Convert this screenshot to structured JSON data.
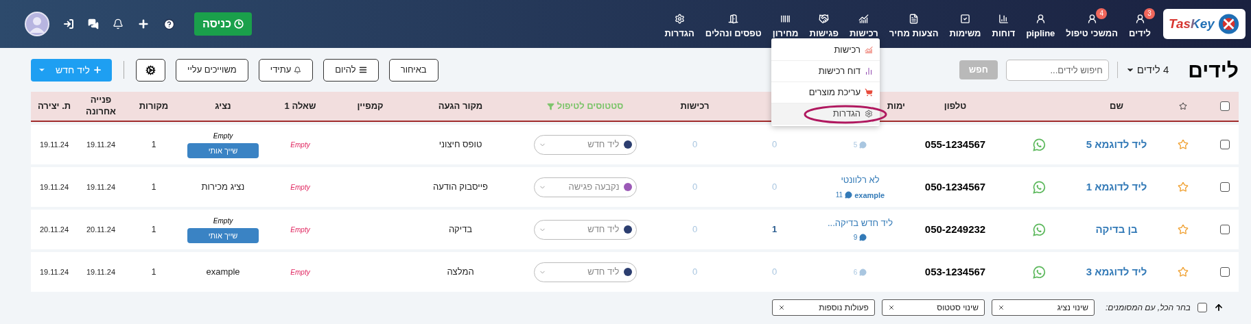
{
  "nav": {
    "logo": "TasKey",
    "items": [
      {
        "label": "לידים",
        "badge": "3"
      },
      {
        "label": "המשכי טיפול",
        "badge": "4"
      },
      {
        "label": "pipline"
      },
      {
        "label": "דוחות"
      },
      {
        "label": "משימות"
      },
      {
        "label": "הצעות מחיר"
      },
      {
        "label": "רכישות"
      },
      {
        "label": "פגישות"
      },
      {
        "label": "מחירון"
      },
      {
        "label": "טפסים ונהלים"
      },
      {
        "label": "הגדרות"
      }
    ],
    "checkin": "כניסה"
  },
  "menu": {
    "items": [
      {
        "label": "רכישות",
        "selected": false,
        "circled": false
      },
      {
        "label": "דוח רכישות",
        "selected": false,
        "circled": false
      },
      {
        "label": "עריכת מוצרים",
        "selected": false,
        "circled": false
      },
      {
        "label": "הגדרות",
        "selected": true,
        "circled": true
      }
    ]
  },
  "toolbar": {
    "title": "לידים",
    "count": "4 לידים",
    "search": {
      "placeholder": "חיפוש לידים..."
    },
    "search_button": {
      "label": "חפש",
      "disabled": true
    },
    "filters": [
      "באיחור",
      "להיום",
      "עתידי",
      "משוייכים עליי"
    ],
    "new_lead": "ליד חדש"
  },
  "table": {
    "columns": [
      {
        "kind": "checkbox",
        "checked": false
      },
      {
        "kind": "star"
      },
      {
        "kind": "text",
        "label": "שם"
      },
      {
        "kind": "blank"
      },
      {
        "kind": "text",
        "label": "טלפון"
      },
      {
        "kind": "partial",
        "label": "ימות"
      },
      {
        "kind": "blank"
      },
      {
        "kind": "text",
        "label": "רכישות"
      },
      {
        "kind": "filter",
        "label": "סטטוסים לטיפול"
      },
      {
        "kind": "text",
        "label": "מקור הגעה"
      },
      {
        "kind": "text",
        "label": "קמפיין"
      },
      {
        "kind": "text",
        "label": "שאלה 1"
      },
      {
        "kind": "text",
        "label": "נציג"
      },
      {
        "kind": "text",
        "label": "מקורות"
      },
      {
        "kind": "text",
        "label": "פנייה אחרונה"
      },
      {
        "kind": "text",
        "label": "ת. יצירה"
      }
    ],
    "rows": [
      {
        "checked": false,
        "starred": false,
        "name": "ליד לדוגמא 5",
        "phone": "055-1234567",
        "task": {
          "comments": "5"
        },
        "column_7": "0",
        "purchases": "0",
        "status": {
          "label": "ליד חדש",
          "color": "#2c3e70"
        },
        "source": "טופס חיצוני",
        "question_1": "Empty",
        "agent": {
          "kind": "unassigned",
          "label": "Empty",
          "button": "שייך אותי"
        },
        "sources": "1",
        "last_contact": "19.11.24",
        "created": "19.11.24"
      },
      {
        "checked": false,
        "starred": false,
        "name": "ליד לדוגמא 1",
        "phone": "050-1234567",
        "task": {
          "title": "לא רלוונטי",
          "comments": "11",
          "tag": "example"
        },
        "column_7": "0",
        "purchases": "0",
        "status": {
          "label": "נקבעה פגישה",
          "color": "#9b59b6"
        },
        "source": "פייסבוק הודעה",
        "question_1": "Empty",
        "agent": {
          "kind": "assigned",
          "label": "נציג מכירות"
        },
        "sources": "1",
        "last_contact": "19.11.24",
        "created": "19.11.24"
      },
      {
        "checked": false,
        "starred": false,
        "name": "בן בדיקה",
        "phone": "050-2249232",
        "task": {
          "title": "ליד חדש בדיקה...",
          "comments": "9"
        },
        "column_7": "1",
        "purchases": "0",
        "status": {
          "label": "ליד חדש",
          "color": "#2c3e70"
        },
        "source": "בדיקה",
        "question_1": "Empty",
        "agent": {
          "kind": "unassigned",
          "label": "Empty",
          "button": "שייך אותי"
        },
        "sources": "1",
        "last_contact": "20.11.24",
        "created": "20.11.24"
      },
      {
        "checked": false,
        "starred": false,
        "name": "ליד לדוגמא 3",
        "phone": "053-1234567",
        "task": {
          "comments": "6"
        },
        "column_7": "0",
        "purchases": "0",
        "status": {
          "label": "ליד חדש",
          "color": "#2c3e70"
        },
        "source": "המלצה",
        "question_1": "Empty",
        "agent": {
          "kind": "assigned",
          "label": "example"
        },
        "sources": "1",
        "last_contact": "19.11.24",
        "created": "19.11.24"
      }
    ]
  },
  "bulk_bar": {
    "select_all": {
      "label": "בחר הכל, עם המסומנים:",
      "checked": false
    },
    "actions": [
      "שינוי נציג",
      "שינוי סטטוס",
      "פעולות נוספות"
    ]
  }
}
